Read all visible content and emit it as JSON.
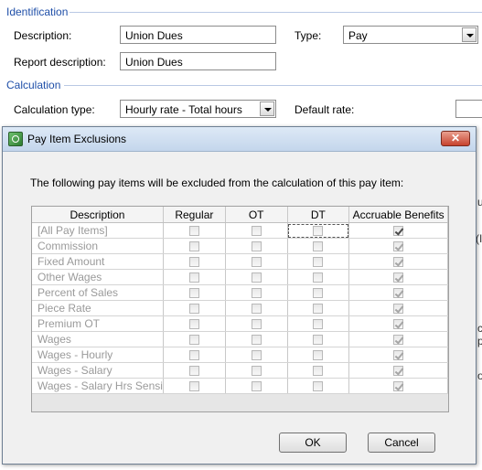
{
  "form": {
    "identification_title": "Identification",
    "description_label": "Description:",
    "description_value": "Union Dues",
    "type_label": "Type:",
    "type_value": "Pay",
    "report_description_label": "Report description:",
    "report_description_value": "Union Dues",
    "calculation_title": "Calculation",
    "calculation_type_label": "Calculation type:",
    "calculation_type_value": "Hourly rate - Total hours",
    "default_rate_label": "Default rate:"
  },
  "dialog": {
    "title": "Pay Item Exclusions",
    "close_glyph": "✕",
    "intro": "The following pay items will be excluded from the calculation of this pay item:",
    "columns": [
      "Description",
      "Regular",
      "OT",
      "DT",
      "Accruable Benefits"
    ],
    "rows": [
      {
        "description": "[All Pay Items]",
        "regular": false,
        "ot": false,
        "dt": false,
        "accruable": true
      },
      {
        "description": "Commission",
        "regular": false,
        "ot": false,
        "dt": false,
        "accruable": true
      },
      {
        "description": "Fixed Amount",
        "regular": false,
        "ot": false,
        "dt": false,
        "accruable": true
      },
      {
        "description": "Other Wages",
        "regular": false,
        "ot": false,
        "dt": false,
        "accruable": true
      },
      {
        "description": "Percent of Sales",
        "regular": false,
        "ot": false,
        "dt": false,
        "accruable": true
      },
      {
        "description": "Piece Rate",
        "regular": false,
        "ot": false,
        "dt": false,
        "accruable": true
      },
      {
        "description": "Premium OT",
        "regular": false,
        "ot": false,
        "dt": false,
        "accruable": true
      },
      {
        "description": "Wages",
        "regular": false,
        "ot": false,
        "dt": false,
        "accruable": true
      },
      {
        "description": "Wages - Hourly",
        "regular": false,
        "ot": false,
        "dt": false,
        "accruable": true
      },
      {
        "description": "Wages - Salary",
        "regular": false,
        "ot": false,
        "dt": false,
        "accruable": true
      },
      {
        "description": "Wages - Salary Hrs Sensi",
        "regular": false,
        "ot": false,
        "dt": false,
        "accruable": true
      }
    ],
    "ok_label": "OK",
    "cancel_label": "Cancel"
  },
  "background_fragments": [
    "u",
    "(I",
    "c p",
    "o"
  ]
}
